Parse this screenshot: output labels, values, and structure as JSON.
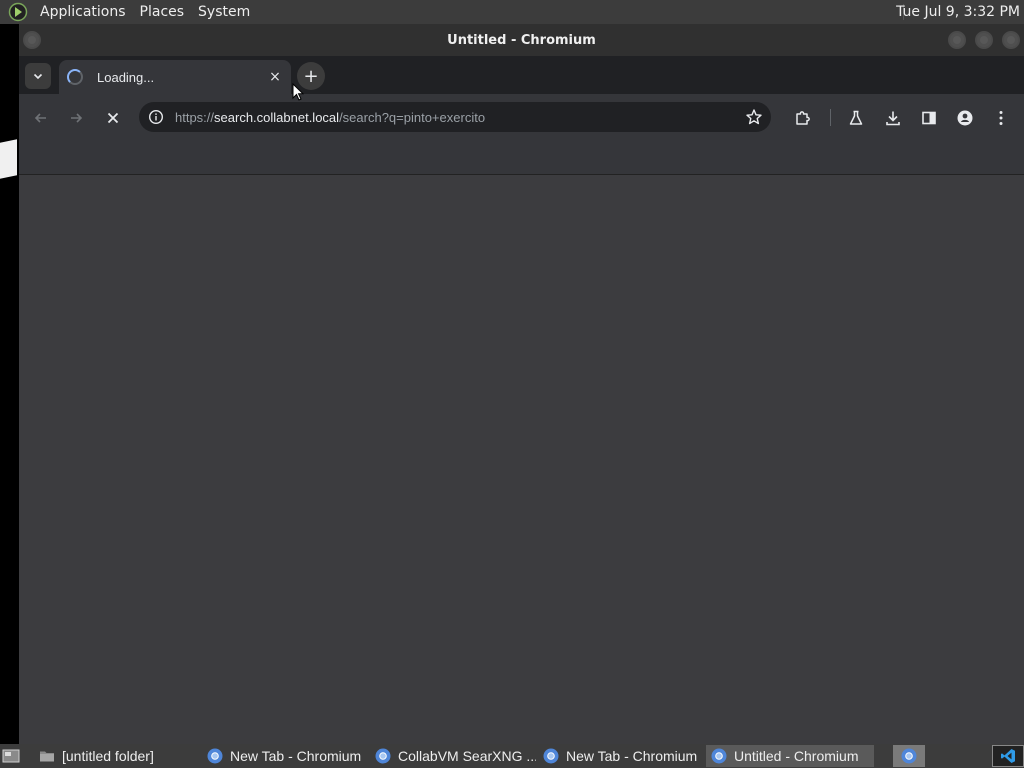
{
  "top_panel": {
    "menu": [
      "Applications",
      "Places",
      "System"
    ],
    "clock": "Tue Jul  9,  3:32 PM"
  },
  "window": {
    "title": "Untitled - Chromium"
  },
  "browser": {
    "tab": {
      "title": "Loading...",
      "close_glyph": "×"
    },
    "new_tab_glyph": "+",
    "omnibox": {
      "scheme": "https://",
      "host": "search.collabnet.local",
      "path": "/search?q=pinto+exercito"
    }
  },
  "taskbar": {
    "tasks": [
      {
        "label": "[untitled folder]",
        "icon": "folder-icon"
      },
      {
        "label": "New Tab - Chromium",
        "icon": "chromium-icon"
      },
      {
        "label": "CollabVM SearXNG ...",
        "icon": "chromium-icon"
      },
      {
        "label": "New Tab - Chromium",
        "icon": "chromium-icon"
      },
      {
        "label": "Untitled - Chromium",
        "icon": "chromium-icon",
        "active": true
      }
    ]
  },
  "colors": {
    "panel": "#3c3c3c",
    "tabstrip": "#202124",
    "toolbar": "#35363a",
    "content": "#3c3c3f",
    "accent": "#8ab4f8"
  }
}
